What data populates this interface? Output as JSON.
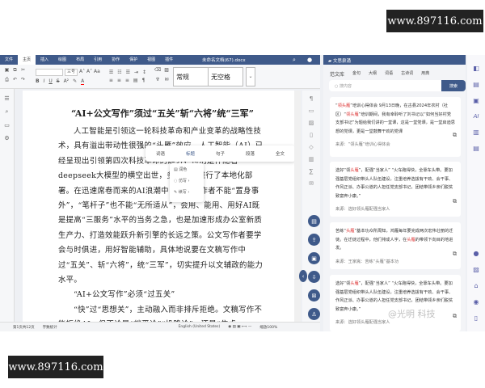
{
  "watermarks": {
    "top": "www.897116.com",
    "bottom": "www.897116.com",
    "overlay": "@光明 科技"
  },
  "titlebar": {
    "tabs": [
      "文件",
      "主页",
      "插入",
      "绘图",
      "布局",
      "引用",
      "协作",
      "保护",
      "视图",
      "插件"
    ],
    "active": 1,
    "doc_title": "未命名文档(67).docx"
  },
  "toolbar": {
    "font_size": "三号",
    "styles": [
      "常规",
      "无空格"
    ]
  },
  "document": {
    "title": "“AI+公文写作”须过“五关”斩“六将”统“三军”",
    "paragraphs": [
      {
        "text": "人工智能是引领这一轮科技革命和产业变革的战略性技术，具有溢出带动性很强的“头雁”效应。人工智能（AI）已经呈现出引领第四次科技革命的趋势，特别是伴随着deepseek大模型的横空出世，多地纷纷进行了本地化部署。在迅速席卷而来的AI浪潮中，公文写作者不能“置身事外”，“笔杆子”也不能“无所适从”，会用、能用、用好AI既是提高“三服务”水平的当务之急，也是加速形成办公室新质生产力、打造效能跃升新引擎的长远之策。公文写作者要学会与时俱进，用好智能辅助，具体地说要在文稿写作中过“五关”、斩“六将”，统“三军”，切实提升以文辅政的能力水平。",
        "indent": true
      },
      {
        "text": "“AI+公文写作”必须“过五关”",
        "indent": true
      },
      {
        "text": "“快”过“思想关”，主动融入而非排斥拒绝。文稿写作不能拒绝AI，但不论是“躺平论”“投降论”，还是“焦虑",
        "indent": true
      }
    ]
  },
  "popup": {
    "items": [
      "词语",
      "标题",
      "句子",
      "段落",
      "全文"
    ],
    "selected": 1,
    "submenu": [
      "润色",
      "仿写",
      "续写"
    ]
  },
  "status": {
    "page": "第1页共12页",
    "wordcount": "字数统计",
    "language": "English (United States)",
    "zoom": "缩放100%"
  },
  "panel": {
    "title": "文思泉涌",
    "tabs": [
      "范文库",
      "金句",
      "大纲",
      "词语",
      "古诗词",
      "用典"
    ],
    "search_placeholder": "搜内容",
    "search_button": "搜索",
    "cards": [
      {
        "parts": [
          "“",
          "领头雁",
          "”培训心得体会 9月13日晚，在古县2024年农村（社区）“",
          "领头雁",
          "”培训期间，我有幸聆听了刘书记以“如何当好村党支部书记”为题给我们讲的一堂课，这是一堂党课，是一堂启迪思想的党课，更是一堂鼓舞干劲的党课"
        ],
        "source": "来源：“领头雁”培训心得体会"
      },
      {
        "parts": [
          "选好“领",
          "头雁",
          "”，配强“当家人” “火车跑得快，全靠车头带。要加强基层党组织带头人队伍建设，注重培养选拔有干劲、会干事、作风正派、办事公道的人担任党支部书记，团结带领乡亲们脱贫致富奔小康。”",
          ""
        ],
        "source": "来源：选好领头雁配强当家人"
      },
      {
        "parts": [
          "苦练“",
          "头雁",
          "”基本功众所周知，鸿雁每年要完成两次宏伟壮丽的迁徙。在迁徙过程中，他们排成人字，在",
          "头雁",
          "的带领下向目的地进发。"
        ],
        "source": "来源：王家胤：苦练“头雁”基本功"
      },
      {
        "parts": [
          "选好“领",
          "头雁",
          "”，配强“当家人” “火车跑得快，全靠车头带。要加强基层党组织带头人队伍建设，注重培养选拔有干劲、会干事、作风正派、办事公道的人担任党支部书记，团结带领乡亲们脱贫致富奔小康。”",
          ""
        ],
        "source": "来源：选好领头雁配强当家人"
      }
    ]
  }
}
